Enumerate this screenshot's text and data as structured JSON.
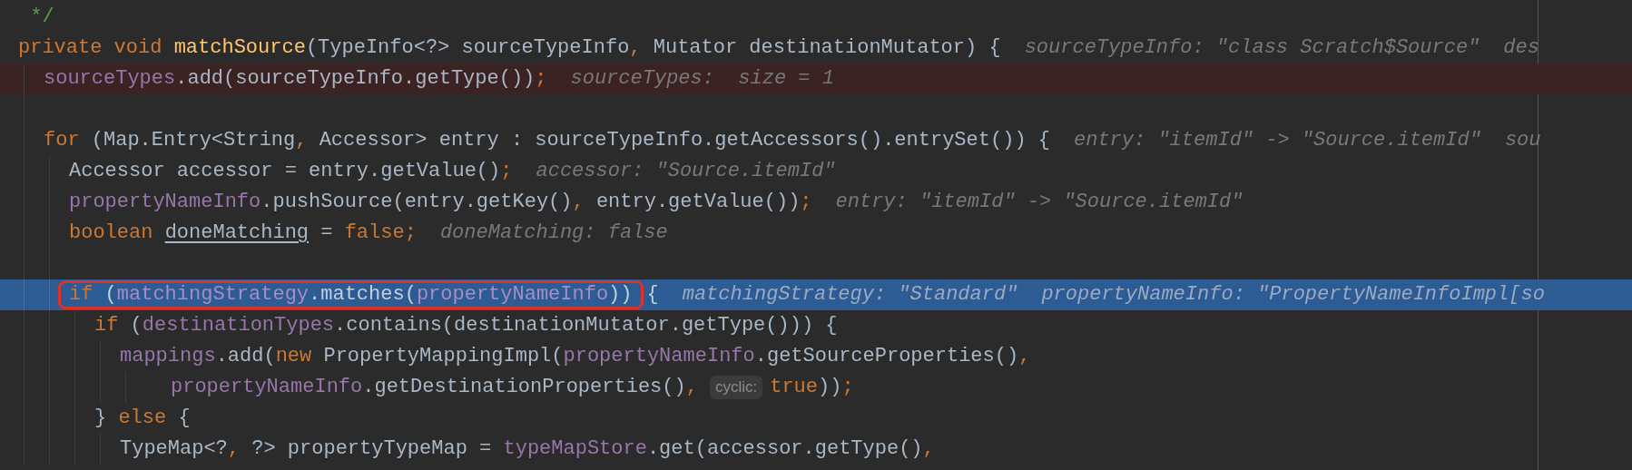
{
  "editor": {
    "lines": [
      {
        "kind": "code",
        "segments": [
          {
            "kind": "code",
            "tokens": [
              {
                "kind": "comment",
                "text": " */"
              }
            ]
          }
        ]
      },
      {
        "kind": "code",
        "segments": [
          {
            "kind": "code",
            "tokens": [
              {
                "kind": "keyword",
                "text": "private void "
              },
              {
                "kind": "method",
                "text": "matchSource"
              },
              {
                "kind": "plain",
                "text": "(TypeInfo<?> sourceTypeInfo"
              },
              {
                "kind": "keyword",
                "text": ","
              },
              {
                "kind": "plain",
                "text": " Mutator destinationMutator) {"
              }
            ]
          },
          {
            "kind": "hint",
            "text": "sourceTypeInfo: \"class Scratch$Source\""
          },
          {
            "kind": "hint",
            "text": "des"
          }
        ],
        "children": [
          {
            "kind": "breakpoint",
            "segments": [
              {
                "kind": "code",
                "tokens": [
                  {
                    "kind": "field",
                    "text": "sourceTypes"
                  },
                  {
                    "kind": "plain",
                    "text": ".add(sourceTypeInfo.getType())"
                  },
                  {
                    "kind": "keyword",
                    "text": ";"
                  }
                ]
              },
              {
                "kind": "hint",
                "text": "sourceTypes:  size = 1"
              }
            ]
          },
          {
            "kind": "blank"
          },
          {
            "kind": "code",
            "segments": [
              {
                "kind": "code",
                "tokens": [
                  {
                    "kind": "keyword",
                    "text": "for "
                  },
                  {
                    "kind": "plain",
                    "text": "(Map.Entry<String"
                  },
                  {
                    "kind": "keyword",
                    "text": ","
                  },
                  {
                    "kind": "plain",
                    "text": " Accessor> entry : sourceTypeInfo.getAccessors().entrySet()) {"
                  }
                ]
              },
              {
                "kind": "hint",
                "text": "entry: \"itemId\" -> \"Source.itemId\""
              },
              {
                "kind": "hint",
                "text": "sou"
              }
            ],
            "children": [
              {
                "kind": "code",
                "segments": [
                  {
                    "kind": "code",
                    "tokens": [
                      {
                        "kind": "plain",
                        "text": "Accessor accessor = entry.getValue()"
                      },
                      {
                        "kind": "keyword",
                        "text": ";"
                      }
                    ]
                  },
                  {
                    "kind": "hint",
                    "text": "accessor: \"Source.itemId\""
                  }
                ]
              },
              {
                "kind": "code",
                "segments": [
                  {
                    "kind": "code",
                    "tokens": [
                      {
                        "kind": "field",
                        "text": "propertyNameInfo"
                      },
                      {
                        "kind": "plain",
                        "text": ".pushSource(entry.getKey()"
                      },
                      {
                        "kind": "keyword",
                        "text": ","
                      },
                      {
                        "kind": "plain",
                        "text": " entry.getValue())"
                      },
                      {
                        "kind": "keyword",
                        "text": ";"
                      }
                    ]
                  },
                  {
                    "kind": "hint",
                    "text": "entry: \"itemId\" -> \"Source.itemId\""
                  }
                ]
              },
              {
                "kind": "code",
                "segments": [
                  {
                    "kind": "code",
                    "tokens": [
                      {
                        "kind": "keyword",
                        "text": "boolean "
                      },
                      {
                        "kind": "reassigned",
                        "text": "doneMatching"
                      },
                      {
                        "kind": "plain",
                        "text": " = "
                      },
                      {
                        "kind": "keyword",
                        "text": "false;"
                      }
                    ]
                  },
                  {
                    "kind": "hint",
                    "text": "doneMatching: false"
                  }
                ]
              },
              {
                "kind": "blank"
              },
              {
                "kind": "execution",
                "segments": [
                  {
                    "kind": "boxed_code",
                    "tokens": [
                      {
                        "kind": "keyword",
                        "text": "if "
                      },
                      {
                        "kind": "plain",
                        "text": "("
                      },
                      {
                        "kind": "field",
                        "text": "matchingStrategy"
                      },
                      {
                        "kind": "plain",
                        "text": ".matches("
                      },
                      {
                        "kind": "field",
                        "text": "propertyNameInfo"
                      },
                      {
                        "kind": "plain",
                        "text": "))"
                      }
                    ]
                  },
                  {
                    "kind": "code",
                    "tokens": [
                      {
                        "kind": "plain",
                        "text": "{"
                      }
                    ]
                  },
                  {
                    "kind": "hint",
                    "text": "matchingStrategy: \"Standard\""
                  },
                  {
                    "kind": "hint",
                    "text": "propertyNameInfo: \"PropertyNameInfoImpl[so"
                  }
                ],
                "children": [
                  {
                    "kind": "code",
                    "segments": [
                      {
                        "kind": "code",
                        "tokens": [
                          {
                            "kind": "keyword",
                            "text": "if "
                          },
                          {
                            "kind": "plain",
                            "text": "("
                          },
                          {
                            "kind": "field",
                            "text": "destinationTypes"
                          },
                          {
                            "kind": "plain",
                            "text": ".contains(destinationMutator.getType())) {"
                          }
                        ]
                      }
                    ],
                    "children": [
                      {
                        "kind": "code",
                        "segments": [
                          {
                            "kind": "code",
                            "tokens": [
                              {
                                "kind": "field",
                                "text": "mappings"
                              },
                              {
                                "kind": "plain",
                                "text": ".add("
                              },
                              {
                                "kind": "keyword",
                                "text": "new "
                              },
                              {
                                "kind": "plain",
                                "text": "PropertyMappingImpl("
                              },
                              {
                                "kind": "field",
                                "text": "propertyNameInfo"
                              },
                              {
                                "kind": "plain",
                                "text": ".getSourceProperties()"
                              },
                              {
                                "kind": "keyword",
                                "text": ","
                              }
                            ]
                          }
                        ],
                        "children": [
                          {
                            "kind": "continuation",
                            "segments": [
                              {
                                "kind": "code",
                                "tokens": [
                                  {
                                    "kind": "field",
                                    "text": "propertyNameInfo"
                                  },
                                  {
                                    "kind": "plain",
                                    "text": ".getDestinationProperties()"
                                  },
                                  {
                                    "kind": "keyword",
                                    "text": ","
                                  }
                                ]
                              },
                              {
                                "kind": "param_hint",
                                "text": "cyclic:"
                              },
                              {
                                "kind": "code",
                                "tokens": [
                                  {
                                    "kind": "keyword",
                                    "text": "true"
                                  },
                                  {
                                    "kind": "plain",
                                    "text": "))"
                                  },
                                  {
                                    "kind": "keyword",
                                    "text": ";"
                                  }
                                ]
                              }
                            ]
                          }
                        ]
                      }
                    ]
                  },
                  {
                    "kind": "code",
                    "segments": [
                      {
                        "kind": "code",
                        "tokens": [
                          {
                            "kind": "plain",
                            "text": "} "
                          },
                          {
                            "kind": "keyword",
                            "text": "else "
                          },
                          {
                            "kind": "plain",
                            "text": "{"
                          }
                        ]
                      }
                    ],
                    "children": [
                      {
                        "kind": "code",
                        "segments": [
                          {
                            "kind": "code",
                            "tokens": [
                              {
                                "kind": "plain",
                                "text": "TypeMap<?"
                              },
                              {
                                "kind": "keyword",
                                "text": ","
                              },
                              {
                                "kind": "plain",
                                "text": " ?> propertyTypeMap = "
                              },
                              {
                                "kind": "field",
                                "text": "typeMapStore"
                              },
                              {
                                "kind": "plain",
                                "text": ".get(accessor.getType()"
                              },
                              {
                                "kind": "keyword",
                                "text": ","
                              }
                            ]
                          }
                        ]
                      }
                    ]
                  }
                ]
              }
            ]
          }
        ]
      }
    ]
  }
}
